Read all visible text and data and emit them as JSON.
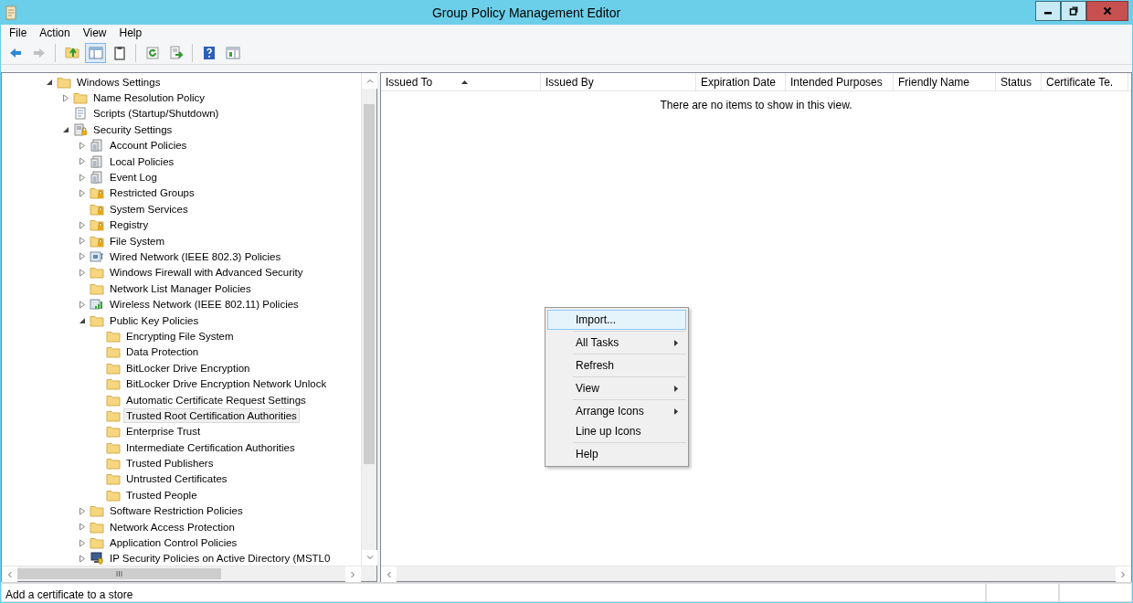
{
  "window": {
    "title": "Group Policy Management Editor"
  },
  "menu": [
    "File",
    "Action",
    "View",
    "Help"
  ],
  "toolbar": [
    {
      "kind": "back",
      "disabled": false,
      "pressed": false
    },
    {
      "kind": "forward",
      "disabled": true,
      "pressed": false
    },
    {
      "kind": "separator"
    },
    {
      "kind": "up",
      "disabled": false,
      "pressed": false
    },
    {
      "kind": "console-tree",
      "disabled": false,
      "pressed": true
    },
    {
      "kind": "clipboard",
      "disabled": false,
      "pressed": false
    },
    {
      "kind": "separator"
    },
    {
      "kind": "refresh",
      "disabled": false,
      "pressed": false
    },
    {
      "kind": "export",
      "disabled": false,
      "pressed": false
    },
    {
      "kind": "separator"
    },
    {
      "kind": "help",
      "disabled": false,
      "pressed": false
    },
    {
      "kind": "action-pane",
      "disabled": false,
      "pressed": false
    }
  ],
  "tree": {
    "items": [
      {
        "label": "Windows Settings",
        "kind": "folder",
        "expanded": true,
        "selected": false,
        "children": [
          {
            "label": "Name Resolution Policy",
            "kind": "folder",
            "expanded": false,
            "selected": false
          },
          {
            "label": "Scripts (Startup/Shutdown)",
            "kind": "script",
            "selected": false
          },
          {
            "label": "Security Settings",
            "kind": "security",
            "expanded": true,
            "selected": false,
            "children": [
              {
                "label": "Account Policies",
                "kind": "policy",
                "expanded": false,
                "selected": false
              },
              {
                "label": "Local Policies",
                "kind": "policy",
                "expanded": false,
                "selected": false
              },
              {
                "label": "Event Log",
                "kind": "policy",
                "expanded": false,
                "selected": false
              },
              {
                "label": "Restricted Groups",
                "kind": "secured-folder",
                "expanded": false,
                "selected": false
              },
              {
                "label": "System Services",
                "kind": "secured-folder",
                "selected": false
              },
              {
                "label": "Registry",
                "kind": "secured-folder",
                "expanded": false,
                "selected": false
              },
              {
                "label": "File System",
                "kind": "secured-folder",
                "expanded": false,
                "selected": false
              },
              {
                "label": "Wired Network (IEEE 802.3) Policies",
                "kind": "wired",
                "expanded": false,
                "selected": false
              },
              {
                "label": "Windows Firewall with Advanced Security",
                "kind": "folder",
                "expanded": false,
                "selected": false
              },
              {
                "label": "Network List Manager Policies",
                "kind": "folder",
                "selected": false
              },
              {
                "label": "Wireless Network (IEEE 802.11) Policies",
                "kind": "wireless",
                "expanded": false,
                "selected": false
              },
              {
                "label": "Public Key Policies",
                "kind": "folder",
                "expanded": true,
                "selected": false,
                "children": [
                  {
                    "label": "Encrypting File System",
                    "kind": "folder",
                    "selected": false
                  },
                  {
                    "label": "Data Protection",
                    "kind": "folder",
                    "selected": false
                  },
                  {
                    "label": "BitLocker Drive Encryption",
                    "kind": "folder",
                    "selected": false
                  },
                  {
                    "label": "BitLocker Drive Encryption Network Unlock",
                    "kind": "folder",
                    "selected": false
                  },
                  {
                    "label": "Automatic Certificate Request Settings",
                    "kind": "folder",
                    "selected": false
                  },
                  {
                    "label": "Trusted Root Certification Authorities",
                    "kind": "folder",
                    "selected": true
                  },
                  {
                    "label": "Enterprise Trust",
                    "kind": "folder",
                    "selected": false
                  },
                  {
                    "label": "Intermediate Certification Authorities",
                    "kind": "folder",
                    "selected": false
                  },
                  {
                    "label": "Trusted Publishers",
                    "kind": "folder",
                    "selected": false
                  },
                  {
                    "label": "Untrusted Certificates",
                    "kind": "folder",
                    "selected": false
                  },
                  {
                    "label": "Trusted People",
                    "kind": "folder",
                    "selected": false
                  }
                ]
              },
              {
                "label": "Software Restriction Policies",
                "kind": "folder",
                "expanded": false,
                "selected": false
              },
              {
                "label": "Network Access Protection",
                "kind": "folder",
                "expanded": false,
                "selected": false
              },
              {
                "label": "Application Control Policies",
                "kind": "folder",
                "expanded": false,
                "selected": false
              },
              {
                "label": "IP Security Policies on Active Directory (MSTL0",
                "kind": "ipsec",
                "expanded": false,
                "selected": false
              }
            ]
          }
        ]
      }
    ]
  },
  "list": {
    "columns": [
      {
        "label": "Issued To",
        "sorted": true
      },
      {
        "label": "Issued By",
        "sorted": false
      },
      {
        "label": "Expiration Date",
        "sorted": false
      },
      {
        "label": "Intended Purposes",
        "sorted": false
      },
      {
        "label": "Friendly Name",
        "sorted": false
      },
      {
        "label": "Status",
        "sorted": false
      },
      {
        "label": "Certificate Te.",
        "sorted": false
      }
    ],
    "empty_message": "There are no items to show in this view."
  },
  "context_menu": {
    "items": [
      {
        "kind": "item",
        "label": "Import...",
        "selected": true,
        "submenu": false
      },
      {
        "kind": "separator"
      },
      {
        "kind": "item",
        "label": "All Tasks",
        "selected": false,
        "submenu": true
      },
      {
        "kind": "separator"
      },
      {
        "kind": "item",
        "label": "Refresh",
        "selected": false,
        "submenu": false
      },
      {
        "kind": "separator"
      },
      {
        "kind": "item",
        "label": "View",
        "selected": false,
        "submenu": true
      },
      {
        "kind": "separator"
      },
      {
        "kind": "item",
        "label": "Arrange Icons",
        "selected": false,
        "submenu": true
      },
      {
        "kind": "item",
        "label": "Line up Icons",
        "selected": false,
        "submenu": false
      },
      {
        "kind": "separator"
      },
      {
        "kind": "item",
        "label": "Help",
        "selected": false,
        "submenu": false
      }
    ]
  },
  "status_bar": {
    "text": "Add a certificate to a store"
  }
}
